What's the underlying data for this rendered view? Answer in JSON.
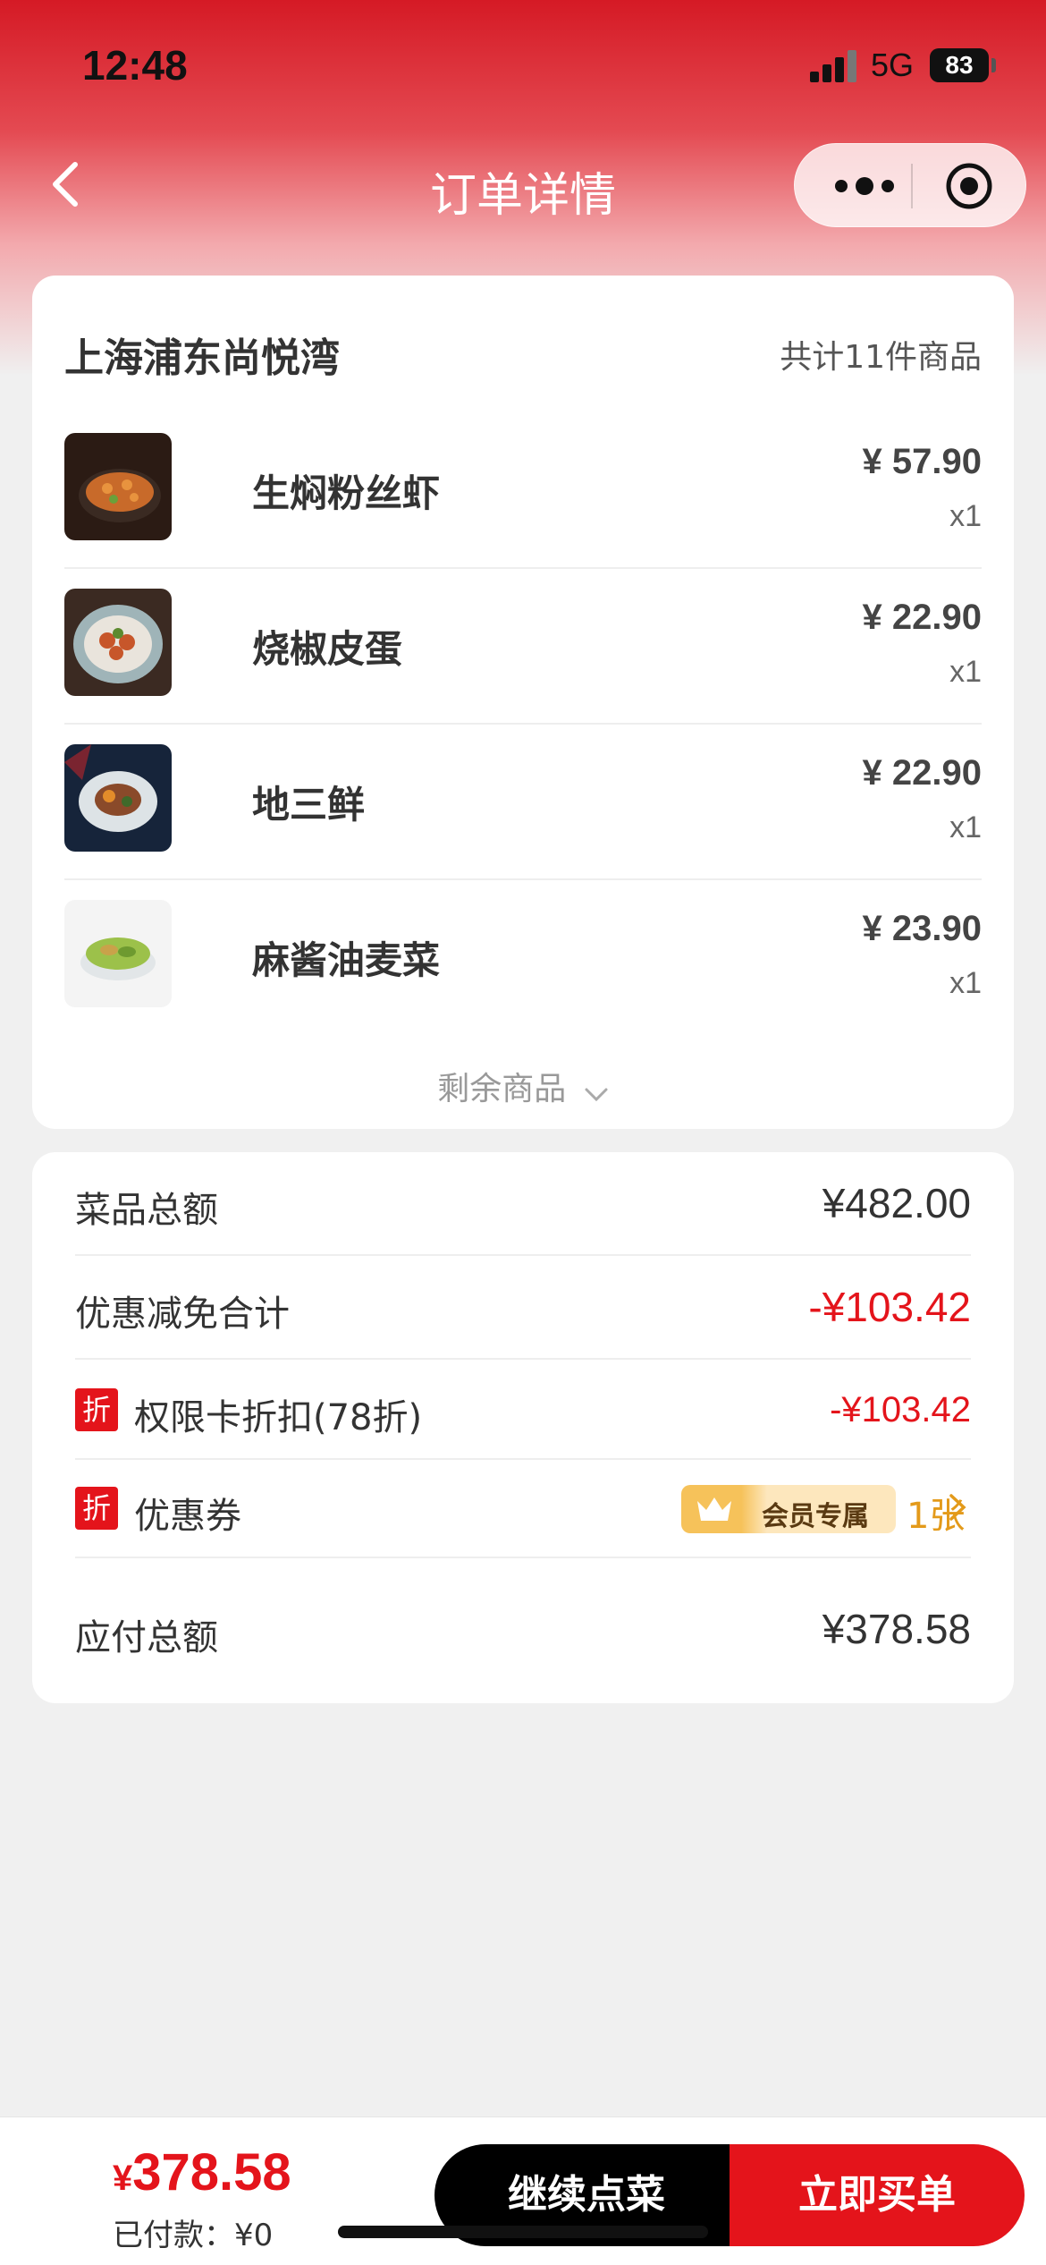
{
  "status_bar": {
    "time": "12:48",
    "network": "5G",
    "battery": "83"
  },
  "nav": {
    "title": "订单详情"
  },
  "order": {
    "store_name": "上海浦东尚悦湾",
    "item_count": "共计11件商品",
    "items": [
      {
        "name": "生焖粉丝虾",
        "price": "¥ 57.90",
        "qty": "x1"
      },
      {
        "name": "烧椒皮蛋",
        "price": "¥ 22.90",
        "qty": "x1"
      },
      {
        "name": "地三鲜",
        "price": "¥ 22.90",
        "qty": "x1"
      },
      {
        "name": "麻酱油麦菜",
        "price": "¥ 23.90",
        "qty": "x1"
      }
    ],
    "remaining_label": "剩余商品"
  },
  "summary": {
    "subtotal_label": "菜品总额",
    "subtotal_value": "¥482.00",
    "discount_label": "优惠减免合计",
    "discount_value": "-¥103.42",
    "card_tag": "折",
    "card_label": "权限卡折扣(78折)",
    "card_value": "-¥103.42",
    "coupon_tag": "折",
    "coupon_label": "优惠券",
    "member_badge": "会员专属",
    "coupon_count": "1张",
    "payable_label": "应付总额",
    "payable_value": "¥378.58"
  },
  "bottom": {
    "currency": "¥",
    "total": "378.58",
    "paid": "已付款：¥0",
    "continue_label": "继续点菜",
    "pay_label": "立即买单"
  },
  "colors": {
    "brand_red": "#e4141b",
    "coupon_orange": "#e39a1a"
  },
  "icons": [
    "back-icon",
    "more-icon",
    "close-target-icon",
    "chevron-down-icon",
    "crown-icon",
    "chevron-right-icon"
  ]
}
